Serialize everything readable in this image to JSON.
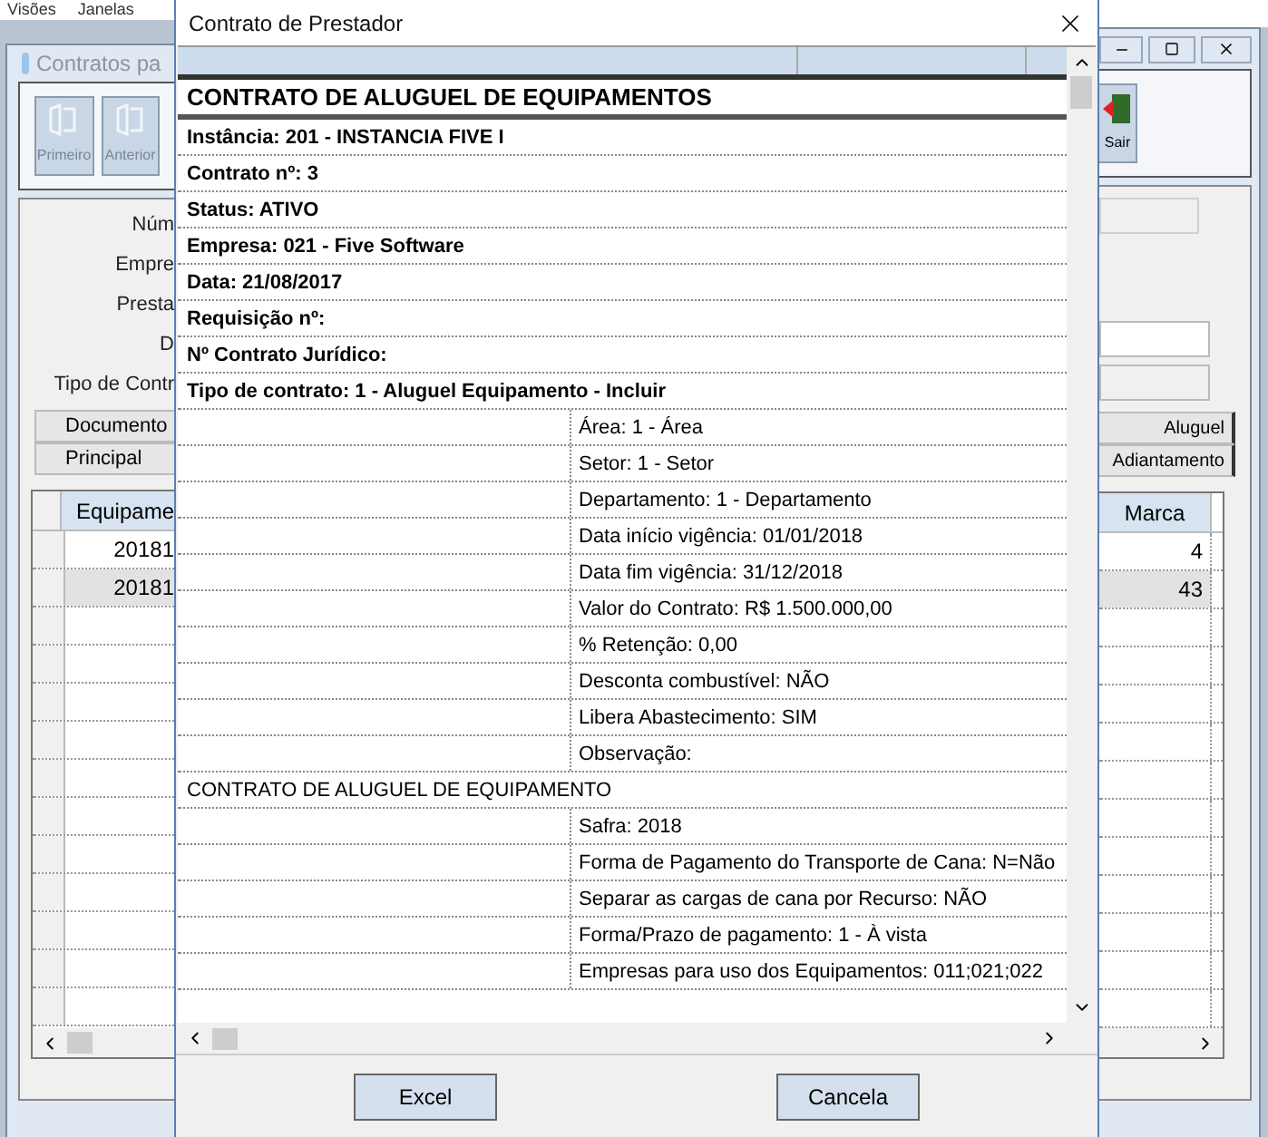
{
  "background_window": {
    "menu": [
      "Visões",
      "Janelas"
    ],
    "title": "Contratos pa",
    "toolbar_left": [
      "Primeiro",
      "Anterior"
    ],
    "toolbar_right": [
      "Sair"
    ],
    "form_labels": [
      "Núm",
      "Empre",
      "Presta",
      "D",
      "Tipo de Contr"
    ],
    "tabs_left": [
      "Documento",
      "Principal"
    ],
    "tabs_right": [
      "Aluguel",
      "Adiantamento"
    ],
    "grid": {
      "columns": [
        "Equipame",
        "Marca"
      ],
      "rows": [
        {
          "column_1": "20181",
          "marca": "4",
          "selected": false
        },
        {
          "column_1": "20181",
          "marca": "43",
          "selected": true
        }
      ]
    }
  },
  "dialog": {
    "title": "Contrato de Prestador",
    "report": {
      "title": "CONTRATO DE ALUGUEL DE EQUIPAMENTOS",
      "rows": [
        {
          "kind": "bold",
          "text": "Instância: 201 - INSTANCIA FIVE I"
        },
        {
          "kind": "bold",
          "text": "Contrato nº: 3"
        },
        {
          "kind": "bold",
          "text": "Status: ATIVO"
        },
        {
          "kind": "bold",
          "text": "Empresa: 021 - Five Software"
        },
        {
          "kind": "bold",
          "text": "Data: 21/08/2017"
        },
        {
          "kind": "bold",
          "text": "Requisição nº:"
        },
        {
          "kind": "bold",
          "text": "Nº Contrato Jurídico:"
        },
        {
          "kind": "bold",
          "text": "Tipo de contrato: 1 - Aluguel Equipamento - Incluir"
        },
        {
          "kind": "split",
          "text": "Área: 1 - Área"
        },
        {
          "kind": "split",
          "text": "Setor: 1 - Setor"
        },
        {
          "kind": "split",
          "text": "Departamento: 1 - Departamento"
        },
        {
          "kind": "split",
          "text": "Data início vigência: 01/01/2018"
        },
        {
          "kind": "split",
          "text": "Data fim vigência: 31/12/2018"
        },
        {
          "kind": "split",
          "text": "Valor do Contrato: R$ 1.500.000,00"
        },
        {
          "kind": "split",
          "text": "% Retenção: 0,00"
        },
        {
          "kind": "split",
          "text": "Desconta combustível: NÃO"
        },
        {
          "kind": "split",
          "text": "Libera Abastecimento: SIM"
        },
        {
          "kind": "split",
          "text": "Observação:"
        },
        {
          "kind": "section",
          "text": "CONTRATO DE ALUGUEL DE EQUIPAMENTO"
        },
        {
          "kind": "split",
          "text": "Safra: 2018"
        },
        {
          "kind": "split",
          "text": "Forma de Pagamento do Transporte de Cana: N=Não"
        },
        {
          "kind": "split",
          "text": "Separar as cargas de cana por Recurso: NÃO"
        },
        {
          "kind": "split",
          "text": "Forma/Prazo de pagamento: 1 - À vista"
        },
        {
          "kind": "split",
          "text": "Empresas para uso dos Equipamentos: 011;021;022"
        }
      ]
    },
    "buttons": [
      "Excel",
      "Cancela"
    ]
  }
}
